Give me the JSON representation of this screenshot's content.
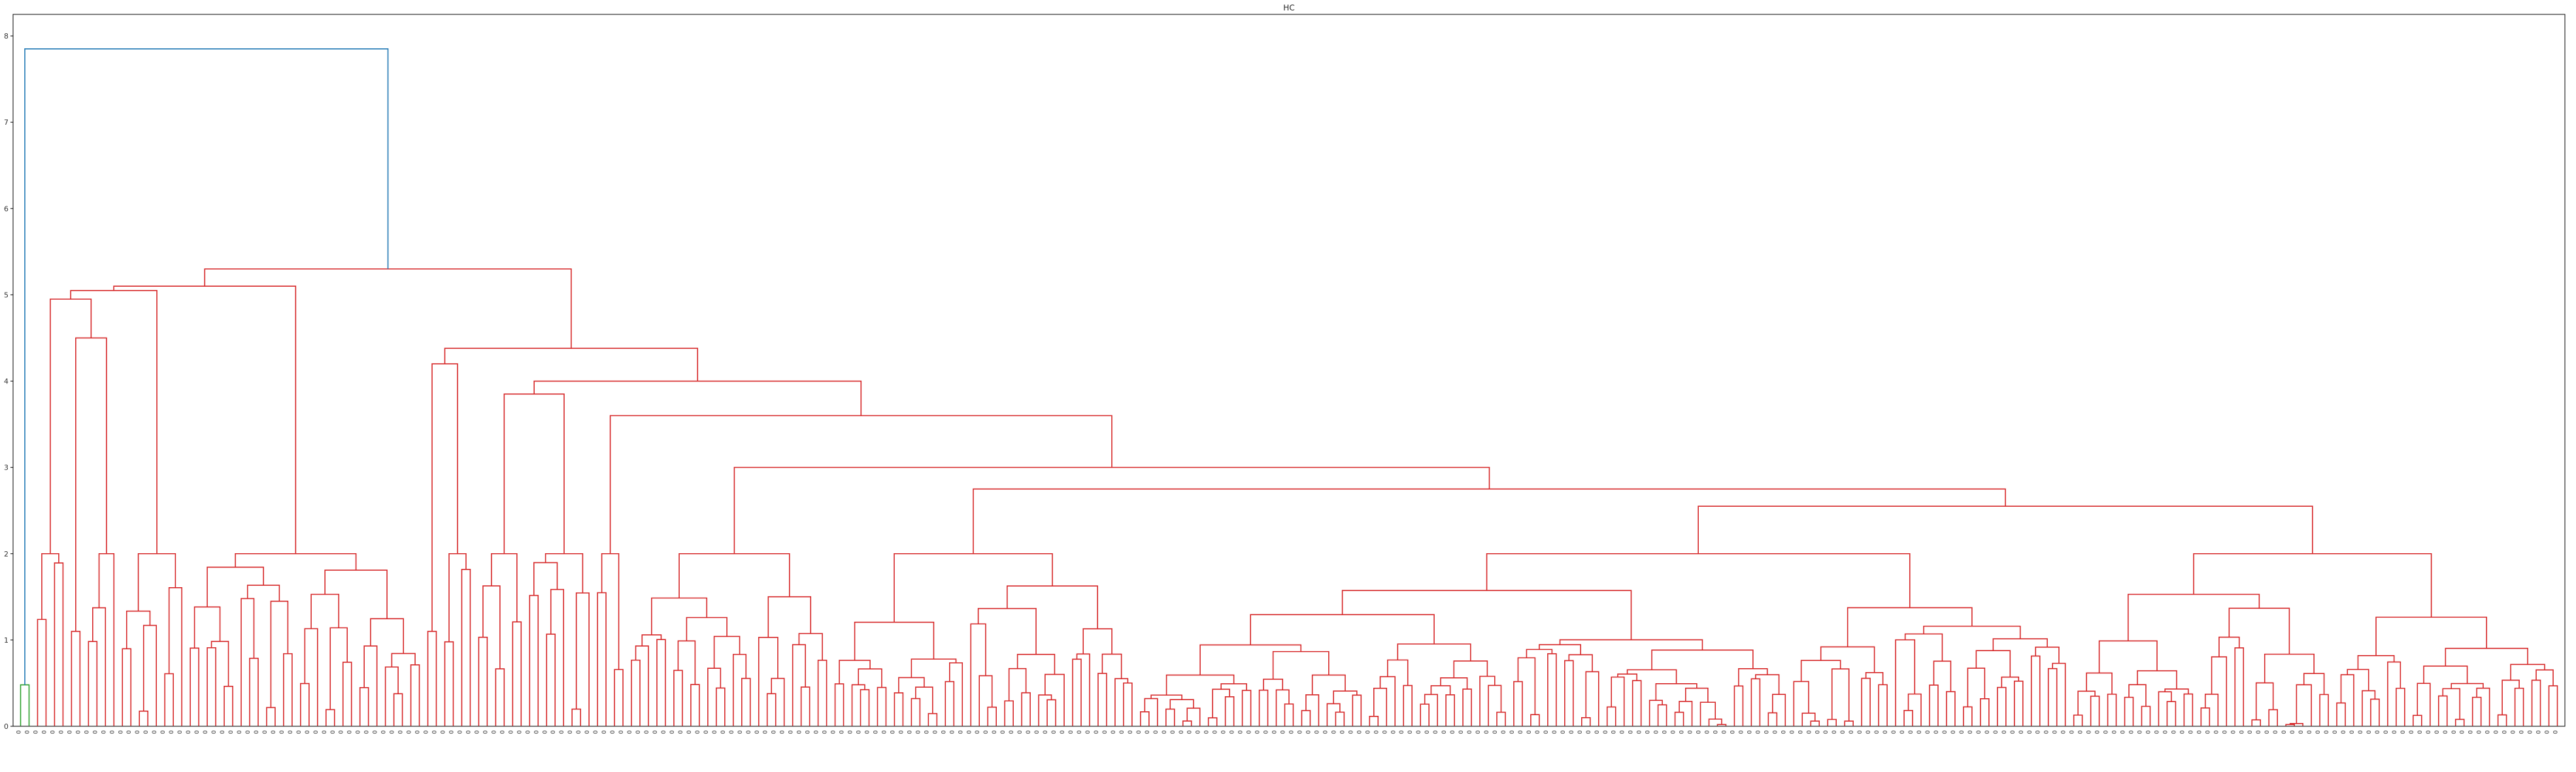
{
  "chart_data": {
    "type": "dendrogram",
    "title": "HC",
    "xlabel": "",
    "ylabel": "",
    "ylim": [
      0,
      8.25
    ],
    "yticks": [
      0,
      1,
      2,
      3,
      4,
      5,
      6,
      7,
      8
    ],
    "leaf_count": 300,
    "leaf_label_text": "0",
    "colors": {
      "root_link": "#1f77b4",
      "main_cluster": "#d62728",
      "small_cluster": "#2ca02c",
      "axis": "#000000",
      "leaf_fill": "#e57373"
    },
    "root_merge_height": 7.85,
    "clusters": [
      {
        "color": "small_cluster",
        "leaves": 2,
        "merge_height": 0.48
      },
      {
        "color": "main_cluster",
        "leaves": 298,
        "merge_height": 5.3
      }
    ],
    "major_merges": [
      {
        "height": 5.3,
        "left_children": 46,
        "right_children": 252
      },
      {
        "height": 5.1,
        "left_children": 18,
        "right_children": 28
      },
      {
        "height": 5.05,
        "left_children": 10,
        "right_children": 8
      },
      {
        "height": 4.95,
        "left_children": 4,
        "right_children": 6
      },
      {
        "height": 4.5,
        "left_children": 2,
        "right_children": 4
      },
      {
        "height": 4.38,
        "left_children": 6,
        "right_children": 246
      },
      {
        "height": 4.2,
        "left_children": 2,
        "right_children": 4
      },
      {
        "height": 4.0,
        "left_children": 14,
        "right_children": 232
      },
      {
        "height": 3.85,
        "left_children": 6,
        "right_children": 8
      },
      {
        "height": 3.6,
        "left_children": 4,
        "right_children": 228
      },
      {
        "height": 3.0,
        "left_children": 24,
        "right_children": 204
      },
      {
        "height": 2.75,
        "left_children": 36,
        "right_children": 168
      },
      {
        "height": 2.55,
        "left_children": 110,
        "right_children": 58
      }
    ]
  }
}
